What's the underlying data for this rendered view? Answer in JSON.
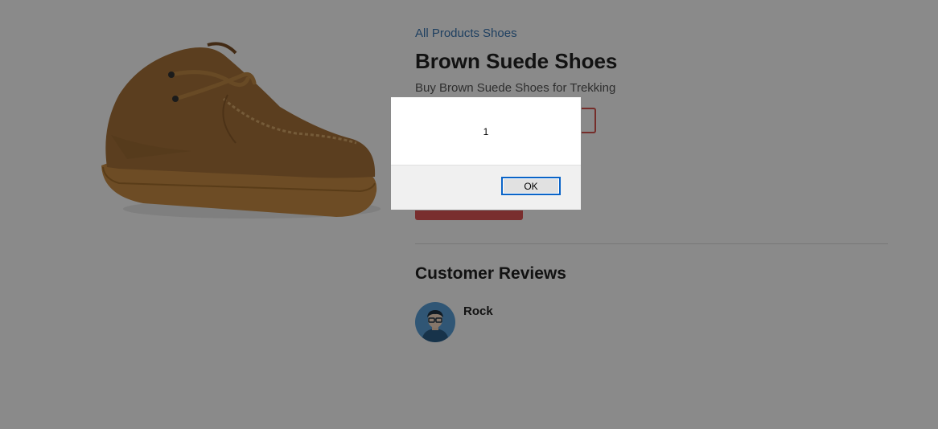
{
  "breadcrumb": {
    "items": [
      "All Products",
      "Shoes"
    ]
  },
  "product": {
    "title": "Brown Suede Shoes",
    "subtitle": "Buy Brown Suede Shoes for Trekking",
    "image_icon": "brown-suede-shoe-image"
  },
  "reviews": {
    "heading": "Customer Reviews",
    "items": [
      {
        "name": "Rock",
        "avatar_icon": "user-avatar-icon"
      }
    ]
  },
  "alert": {
    "message": "1",
    "ok_label": "OK"
  },
  "colors": {
    "link": "#3a76b3",
    "accent": "#e05555",
    "overlay": "rgba(0,0,0,0.46)",
    "focus": "#0a64c8"
  }
}
